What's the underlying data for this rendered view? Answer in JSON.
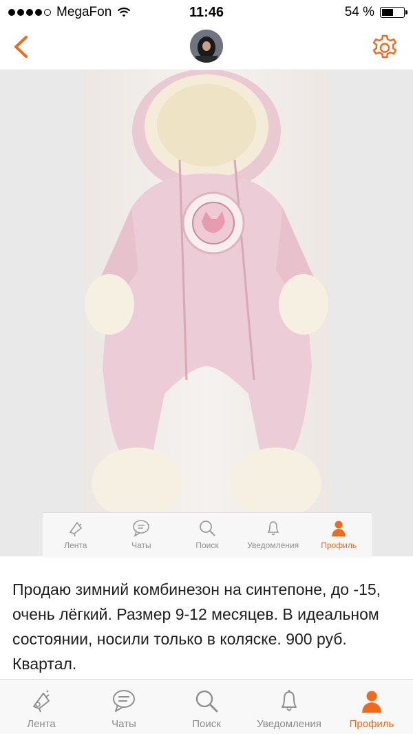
{
  "status_bar": {
    "carrier": "MegaFon",
    "time": "11:46",
    "battery": "54 %",
    "battery_level": 0.54
  },
  "header": {
    "back_icon": "chevron-left-icon",
    "settings_icon": "gear-icon",
    "accent_color": "#f06a1d"
  },
  "post": {
    "description": "Продаю зимний комбинезон на синтепоне, до -15, очень лёгкий. Размер 9-12 месяцев. В идеальном состоянии, носили только в коляске. 900 руб. Квартал."
  },
  "photo_tabbar": {
    "items": [
      {
        "label": "Лента",
        "icon": "feed-icon"
      },
      {
        "label": "Чаты",
        "icon": "chat-icon"
      },
      {
        "label": "Поиск",
        "icon": "search-icon"
      },
      {
        "label": "Уведомления",
        "icon": "bell-icon"
      },
      {
        "label": "Профиль",
        "icon": "profile-icon"
      }
    ]
  },
  "tabbar": {
    "active": "Профиль",
    "items": [
      {
        "label": "Лента",
        "icon": "feed-icon"
      },
      {
        "label": "Чаты",
        "icon": "chat-icon"
      },
      {
        "label": "Поиск",
        "icon": "search-icon"
      },
      {
        "label": "Уведомления",
        "icon": "bell-icon"
      },
      {
        "label": "Профиль",
        "icon": "profile-icon"
      }
    ]
  }
}
